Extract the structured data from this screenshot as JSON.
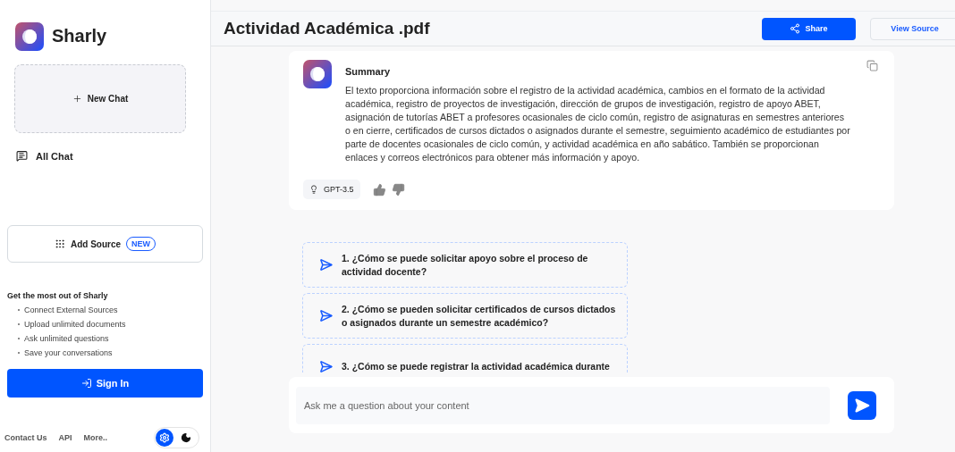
{
  "sidebar": {
    "brand": "Sharly",
    "new_chat": "New Chat",
    "all_chat": "All Chat",
    "add_source": {
      "label": "Add Source",
      "badge": "NEW"
    },
    "promo": {
      "title": "Get the most out of Sharly",
      "items": [
        "Connect External Sources",
        "Upload unlimited documents",
        "Ask unlimited questions",
        "Save your conversations"
      ]
    },
    "sign_in": "Sign In",
    "footer_links": [
      "Contact Us",
      "API",
      "More.."
    ],
    "theme_toggle": [
      {
        "kind": "light",
        "selected": true
      },
      {
        "kind": "dark",
        "selected": false
      }
    ]
  },
  "header": {
    "title": "Actividad Académica .pdf",
    "buttons": [
      {
        "kind": "primary",
        "label": "Share"
      },
      {
        "kind": "outline",
        "label": "View Source"
      }
    ]
  },
  "summary": {
    "title": "Summary",
    "text": "El texto proporciona información sobre el registro de la actividad académica, cambios en el formato de la actividad académica, registro de proyectos de investigación, dirección de grupos de investigación, registro de apoyo ABET, asignación de tutorías ABET a profesores ocasionales de ciclo común, registro de asignaturas en semestres anteriores o en cierre, certificados de cursos dictados o asignados durante el semestre, seguimiento académico de estudiantes por parte de docentes ocasionales de ciclo común, y actividad académica en año sabático. También se proporcionan enlaces y correos electrónicos para obtener más información y apoyo.",
    "model": "GPT-3.5"
  },
  "questions": [
    "1. ¿Cómo se puede solicitar apoyo sobre el proceso de actividad docente?",
    "2. ¿Cómo se pueden solicitar certificados de cursos dictados o asignados durante un semestre académico?",
    "3. ¿Cómo se puede registrar la actividad académica durante"
  ],
  "input": {
    "placeholder": "Ask me a question about your content"
  }
}
